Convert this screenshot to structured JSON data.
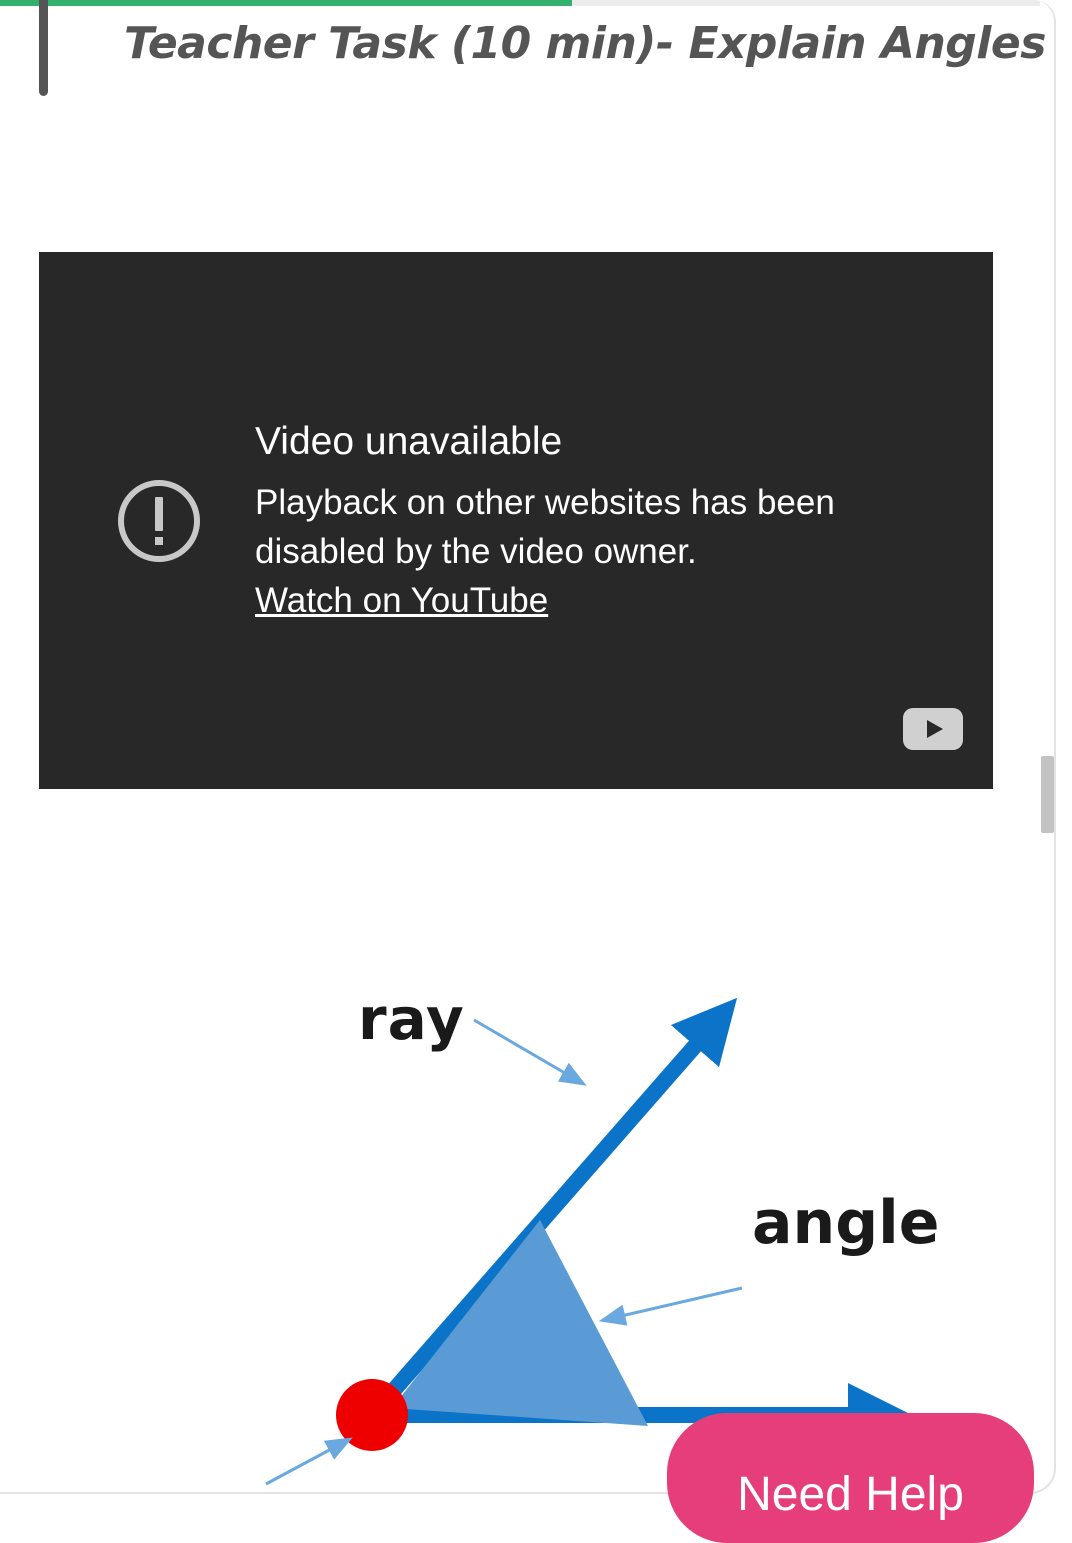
{
  "lesson": {
    "title": "Teacher Task (10 min)- Explain Angles",
    "progress": 0.55
  },
  "video": {
    "title": "Video unavailable",
    "message": "Playback on other websites has been disabled by the video owner.",
    "link_label": "Watch on YouTube",
    "icons": {
      "warning": "exclamation-circle-icon",
      "logo": "youtube-logo-icon"
    }
  },
  "diagram": {
    "labels": {
      "ray": "ray",
      "angle": "angle"
    },
    "colors": {
      "ray": "#0b73c8",
      "angle_fill": "#5b9bd5",
      "vertex": "#ee0000"
    }
  },
  "help": {
    "label": "Need Help"
  },
  "colors": {
    "accent": "#34b16d",
    "help_button": "#e63e7a",
    "video_bg": "#282828"
  }
}
